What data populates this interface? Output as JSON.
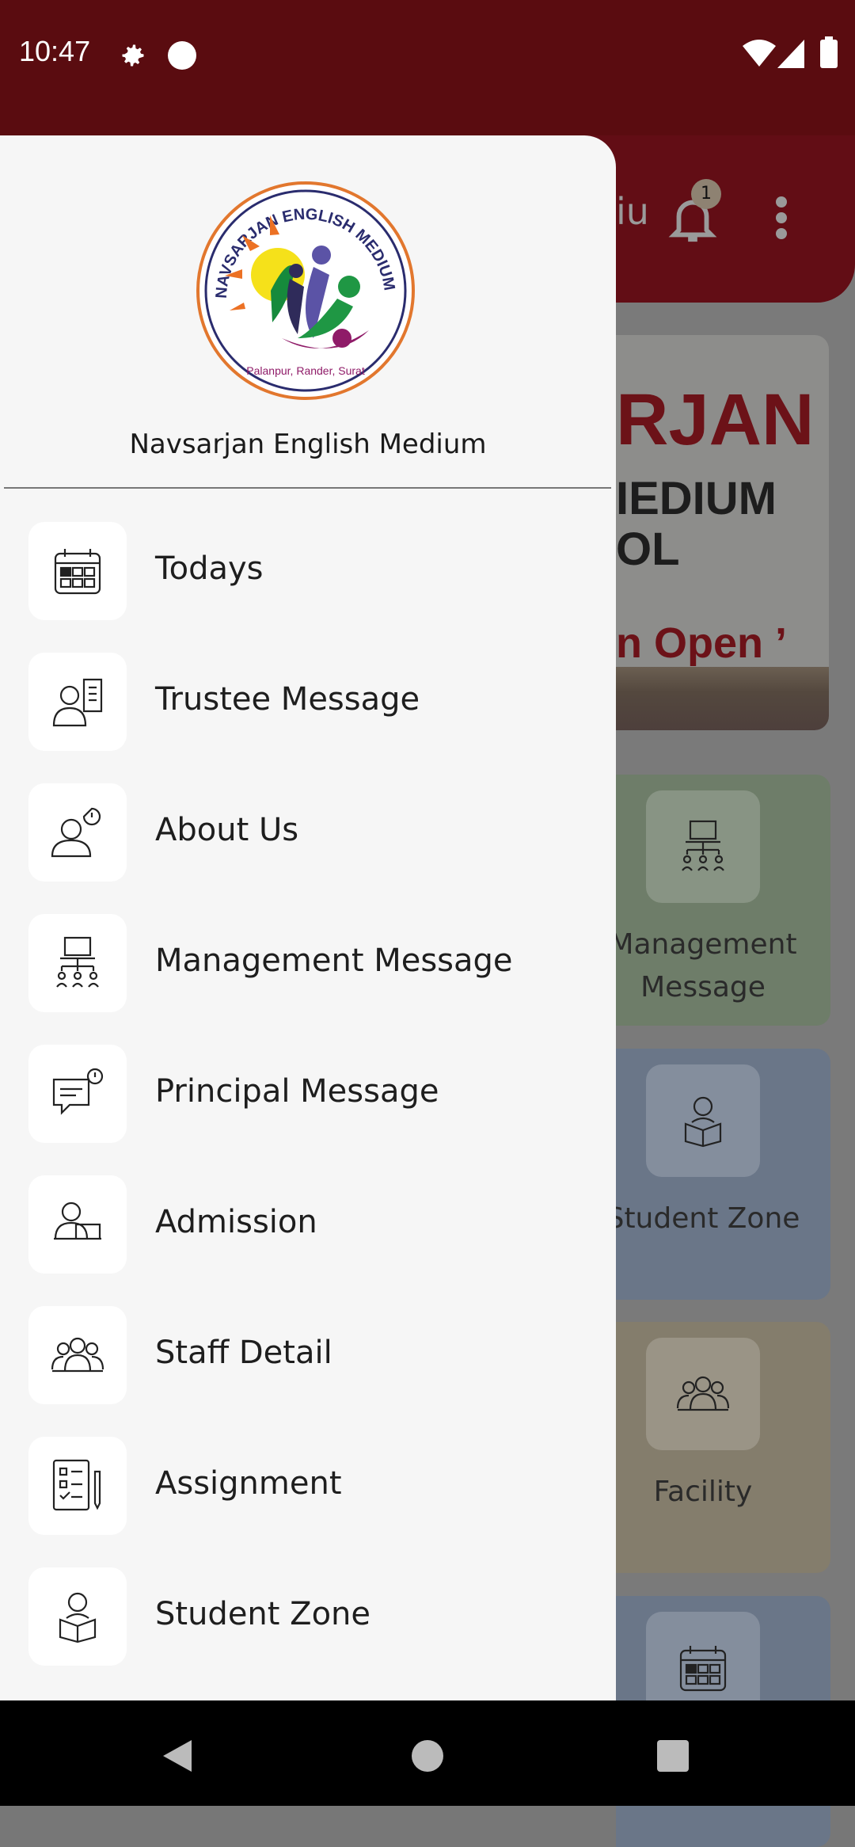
{
  "status_bar": {
    "time": "10:47",
    "icons": [
      "settings-icon",
      "dot-icon",
      "wifi-icon",
      "signal-icon",
      "battery-icon"
    ]
  },
  "background": {
    "header_text": "iu",
    "notification_count": "1",
    "banner": {
      "line1": "RJAN",
      "line2": "IEDIUM",
      "line3": "OL",
      "line4": "n Open ’"
    },
    "cards": [
      {
        "label": "Management Message",
        "color": "#6e7d69",
        "icon": "management-icon"
      },
      {
        "label": "Student Zone",
        "color": "#6a7688",
        "icon": "student-icon"
      },
      {
        "label": "Facility",
        "color": "#847d6c",
        "icon": "group-icon"
      },
      {
        "label": "",
        "color": "#6a7688",
        "icon": "calendar-icon"
      }
    ]
  },
  "drawer": {
    "logo_text": "NAVSARJAN ENGLISH MEDIUM SCHOOL · Palanpur, Rander, Surat",
    "title": "Navsarjan English Medium",
    "items": [
      {
        "label": "Todays",
        "icon": "calendar-icon"
      },
      {
        "label": "Trustee Message",
        "icon": "trustee-icon"
      },
      {
        "label": "About Us",
        "icon": "person-info-icon"
      },
      {
        "label": "Management Message",
        "icon": "management-icon"
      },
      {
        "label": "Principal Message",
        "icon": "chat-icon"
      },
      {
        "label": "Admission",
        "icon": "admission-icon"
      },
      {
        "label": "Staff Detail",
        "icon": "group-icon"
      },
      {
        "label": "Assignment",
        "icon": "assignment-icon"
      },
      {
        "label": "Student Zone",
        "icon": "student-icon"
      }
    ]
  }
}
